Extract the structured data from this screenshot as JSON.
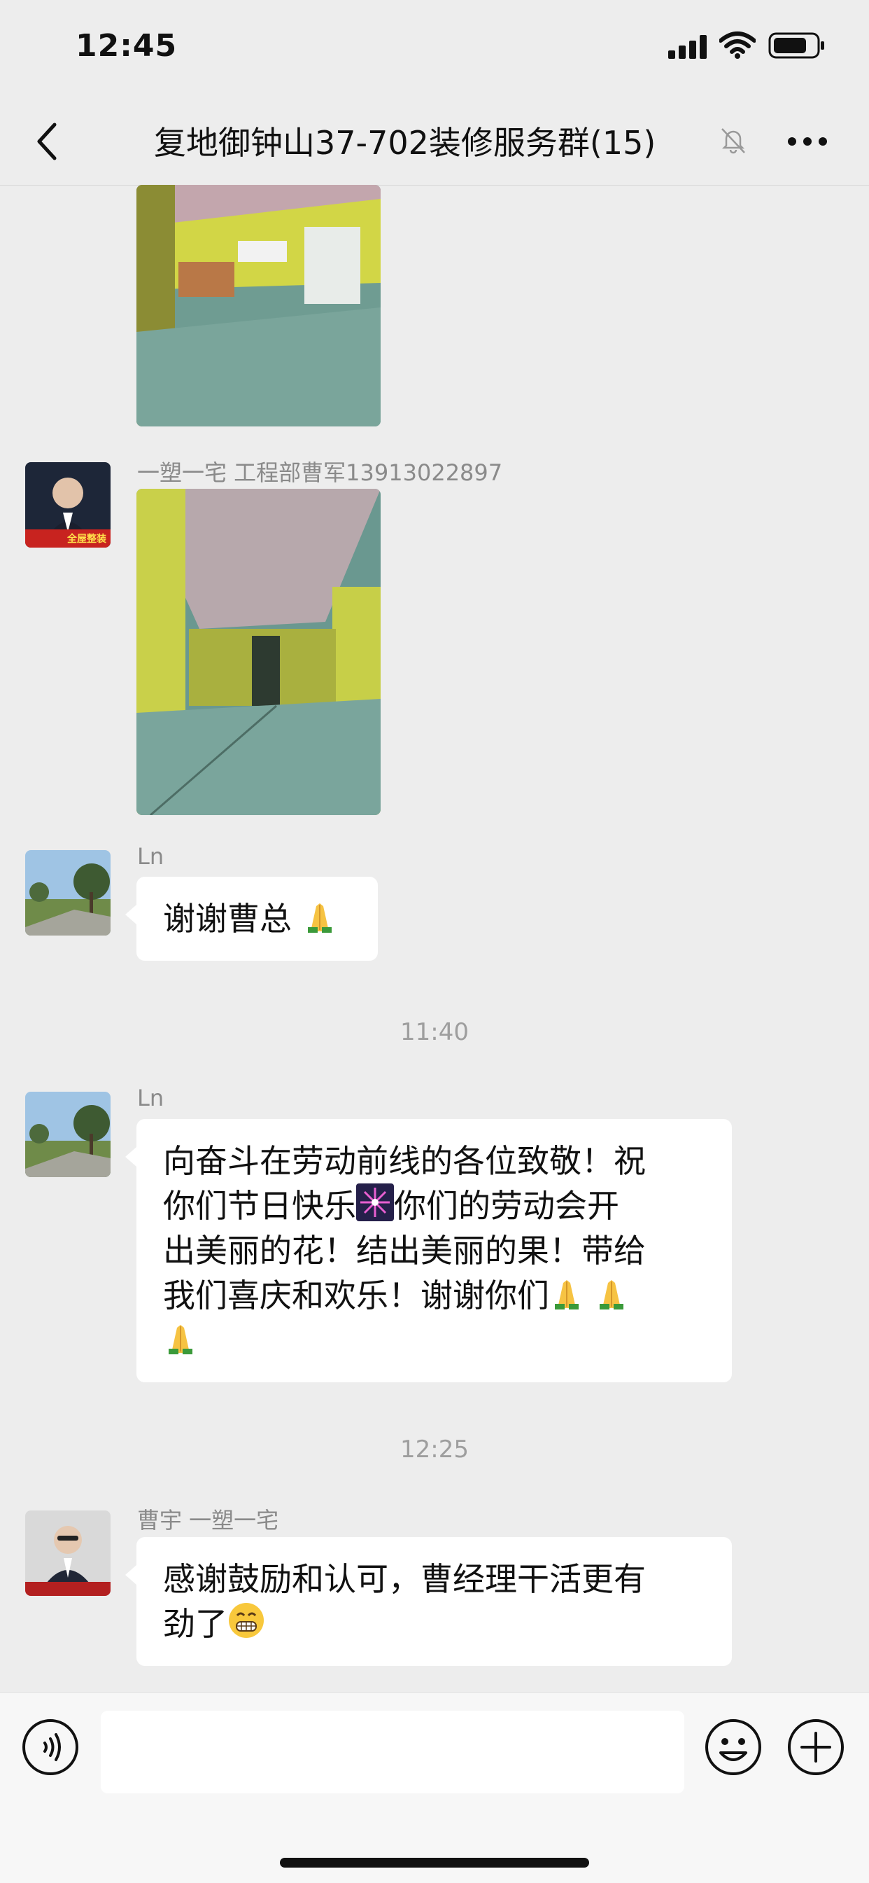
{
  "status_bar": {
    "time": "12:45"
  },
  "header": {
    "title": "复地御钟山37-702装修服务群(15)"
  },
  "messages": [
    {
      "type": "image",
      "alt": ""
    },
    {
      "type": "image",
      "sender": "一塑一宅 工程部曹军13913022897"
    },
    {
      "type": "text",
      "sender": "Ln",
      "text": "谢谢曹总"
    },
    {
      "type": "time",
      "text": "11:40"
    },
    {
      "type": "text",
      "sender": "Ln",
      "lines": [
        "向奋斗在劳动前线的各位致敬！祝",
        "你们节日快乐",
        "你们的劳动会开",
        "出美丽的花！结出美丽的果！带给",
        "我们喜庆和欢乐！谢谢你们"
      ]
    },
    {
      "type": "time",
      "text": "12:25"
    },
    {
      "type": "text",
      "sender": "曹宇 一塑一宅",
      "lines": [
        "感谢鼓励和认可，曹经理干活更有",
        "劲了"
      ]
    }
  ],
  "avatar_captions": {
    "caoj": "全屋整装"
  },
  "input": {
    "placeholder": ""
  },
  "colors": {
    "background": "#ededed",
    "bubble": "#ffffff",
    "meta_text": "#8a8a8a"
  },
  "icons": [
    "back-icon",
    "mute-bell-icon",
    "more-icon",
    "voice-icon",
    "emoji-icon",
    "plus-icon",
    "folded-hands-emoji",
    "fireworks-emoji",
    "grin-emoji"
  ]
}
